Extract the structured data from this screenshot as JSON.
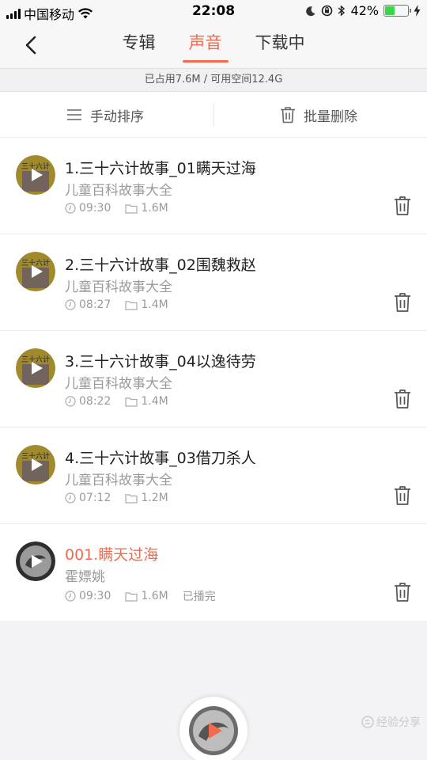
{
  "status_bar": {
    "carrier": "中国移动",
    "time": "22:08",
    "battery": "42%",
    "battery_level": 0.42
  },
  "nav": {
    "tabs": [
      "专辑",
      "声音",
      "下载中"
    ],
    "active_tab": 1
  },
  "storage": {
    "text": "已占用7.6M / 可用空间12.4G"
  },
  "actions": {
    "sort_label": "手动排序",
    "batch_delete_label": "批量删除"
  },
  "items": [
    {
      "title": "1.三十六计故事_01瞒天过海",
      "album": "儿童百科故事大全",
      "duration": "09:30",
      "size": "1.6M",
      "status": ""
    },
    {
      "title": "2.三十六计故事_02围魏救赵",
      "album": "儿童百科故事大全",
      "duration": "08:27",
      "size": "1.4M",
      "status": ""
    },
    {
      "title": "3.三十六计故事_04以逸待劳",
      "album": "儿童百科故事大全",
      "duration": "08:22",
      "size": "1.4M",
      "status": ""
    },
    {
      "title": "4.三十六计故事_03借刀杀人",
      "album": "儿童百科故事大全",
      "duration": "07:12",
      "size": "1.2M",
      "status": ""
    },
    {
      "title": "001.瞒天过海",
      "album": "霍嫖姚",
      "duration": "09:30",
      "size": "1.6M",
      "status": "已播完"
    }
  ],
  "cover_text": "三十六计",
  "watermark": "经验分享",
  "colors": {
    "accent": "#f26b4e",
    "playing_title": "#ef6b4f",
    "battery": "#3dd34c"
  }
}
